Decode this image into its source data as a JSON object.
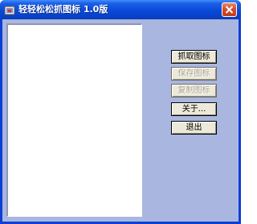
{
  "window": {
    "title": "轻轻松松抓图标 1.0版",
    "icons": {
      "app": "app-icon",
      "close": "close-icon"
    }
  },
  "buttons": {
    "capture": {
      "label": "抓取图标",
      "enabled": true
    },
    "save": {
      "label": "保存图标",
      "enabled": false
    },
    "copy": {
      "label": "复制图标",
      "enabled": false
    },
    "about": {
      "label": "关于...",
      "enabled": true
    },
    "exit": {
      "label": "退出",
      "enabled": true
    }
  },
  "colors": {
    "titlebar": "#0a49d8",
    "client_background": "#a9b6df",
    "canvas_background": "#ffffff",
    "close_button": "#d9502c"
  }
}
